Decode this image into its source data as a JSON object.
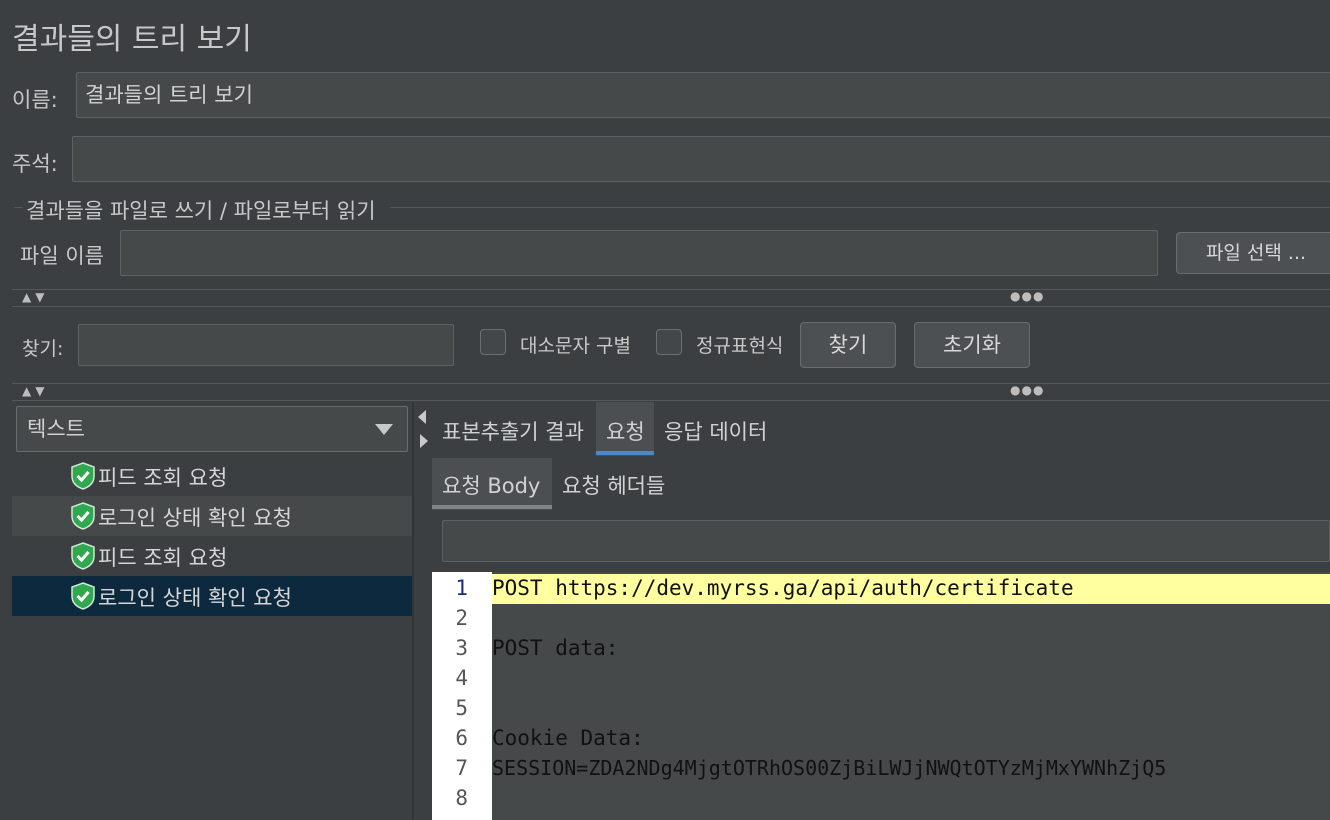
{
  "title": "결과들의 트리 보기",
  "name": {
    "label": "이름:",
    "value": "결과들의 트리 보기"
  },
  "comment": {
    "label": "주석:",
    "value": ""
  },
  "file_group": {
    "legend": "결과들을 파일로 쓰기 / 파일로부터 읽기",
    "file_label": "파일 이름",
    "file_value": "",
    "browse_button": "파일 선택 ..."
  },
  "search": {
    "label": "찾기:",
    "value": "",
    "case_sensitive_label": "대소문자 구별",
    "regex_label": "정규표현식",
    "search_button": "찾기",
    "reset_button": "초기화"
  },
  "renderer": {
    "selected": "텍스트"
  },
  "tree": {
    "items": [
      {
        "label": "피드 조회 요청",
        "status": "success"
      },
      {
        "label": "로그인 상태 확인 요청",
        "status": "success"
      },
      {
        "label": "피드 조회 요청",
        "status": "success"
      },
      {
        "label": "로그인 상태 확인 요청",
        "status": "success"
      }
    ]
  },
  "tabs": {
    "main": [
      "표본추출기 결과",
      "요청",
      "응답 데이터"
    ],
    "active_main": "요청",
    "sub": [
      "요청 Body",
      "요청 헤더들"
    ],
    "active_sub": "요청 Body"
  },
  "request_body": {
    "lines": [
      {
        "n": "1",
        "text": "POST https://dev.myrss.ga/api/auth/certificate"
      },
      {
        "n": "2",
        "text": ""
      },
      {
        "n": "3",
        "text": "POST data:"
      },
      {
        "n": "4",
        "text": ""
      },
      {
        "n": "5",
        "text": ""
      },
      {
        "n": "6",
        "text": "Cookie Data:"
      },
      {
        "n": "7",
        "text": "SESSION=ZDA2NDg4MjgtOTRhOS00ZjBiLWJjNWQtOTYzMjMxYWNhZjQ5"
      },
      {
        "n": "8",
        "text": ""
      }
    ]
  },
  "colors": {
    "background": "#3c3f41",
    "accent_tab": "#4a88c7",
    "selected_row": "#0d293e",
    "success_icon": "#2fa84f",
    "highlight_line": "#ffffa0",
    "url_text": "#0a7a0a"
  }
}
